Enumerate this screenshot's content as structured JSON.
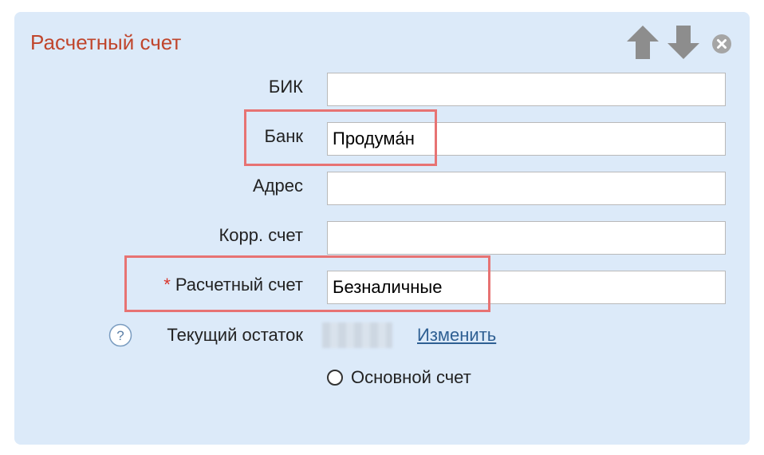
{
  "panel": {
    "title": "Расчетный счет",
    "colors": {
      "background": "#dceaf9",
      "title": "#c0462d",
      "highlight": "#e77373",
      "link": "#2e5f93",
      "required_star": "#d9342b"
    },
    "icons": {
      "move_up": "arrow-up-icon",
      "move_down": "arrow-down-icon",
      "close": "close-icon"
    }
  },
  "form": {
    "bik": {
      "label": "БИК",
      "value": ""
    },
    "bank": {
      "label": "Банк",
      "value": "Продума́н"
    },
    "address": {
      "label": "Адрес",
      "value": ""
    },
    "corr_account": {
      "label": "Корр. счет",
      "value": ""
    },
    "account": {
      "required_mark": "*",
      "label": "Расчетный счет",
      "value": "Безналичные"
    },
    "balance": {
      "label": "Текущий остаток",
      "help_icon": "question-circle-icon",
      "change_link": "Изменить"
    },
    "main_account": {
      "label": "Основной счет",
      "checked": false
    }
  }
}
